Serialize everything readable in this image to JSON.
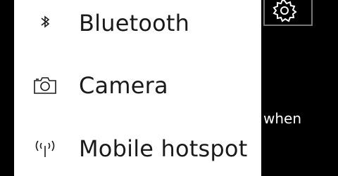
{
  "menu": {
    "items": [
      {
        "icon": "bluetooth-icon",
        "label": "Bluetooth"
      },
      {
        "icon": "camera-icon",
        "label": "Camera"
      },
      {
        "icon": "mobile-hotspot-icon",
        "label": "Mobile hotspot"
      }
    ]
  },
  "background": {
    "tile_icon": "gear-icon",
    "partial_text": "when"
  },
  "colors": {
    "menu_background": "#ffffff",
    "menu_text": "#1a1a1a",
    "page_background": "#000000",
    "tile_border": "#767676"
  }
}
